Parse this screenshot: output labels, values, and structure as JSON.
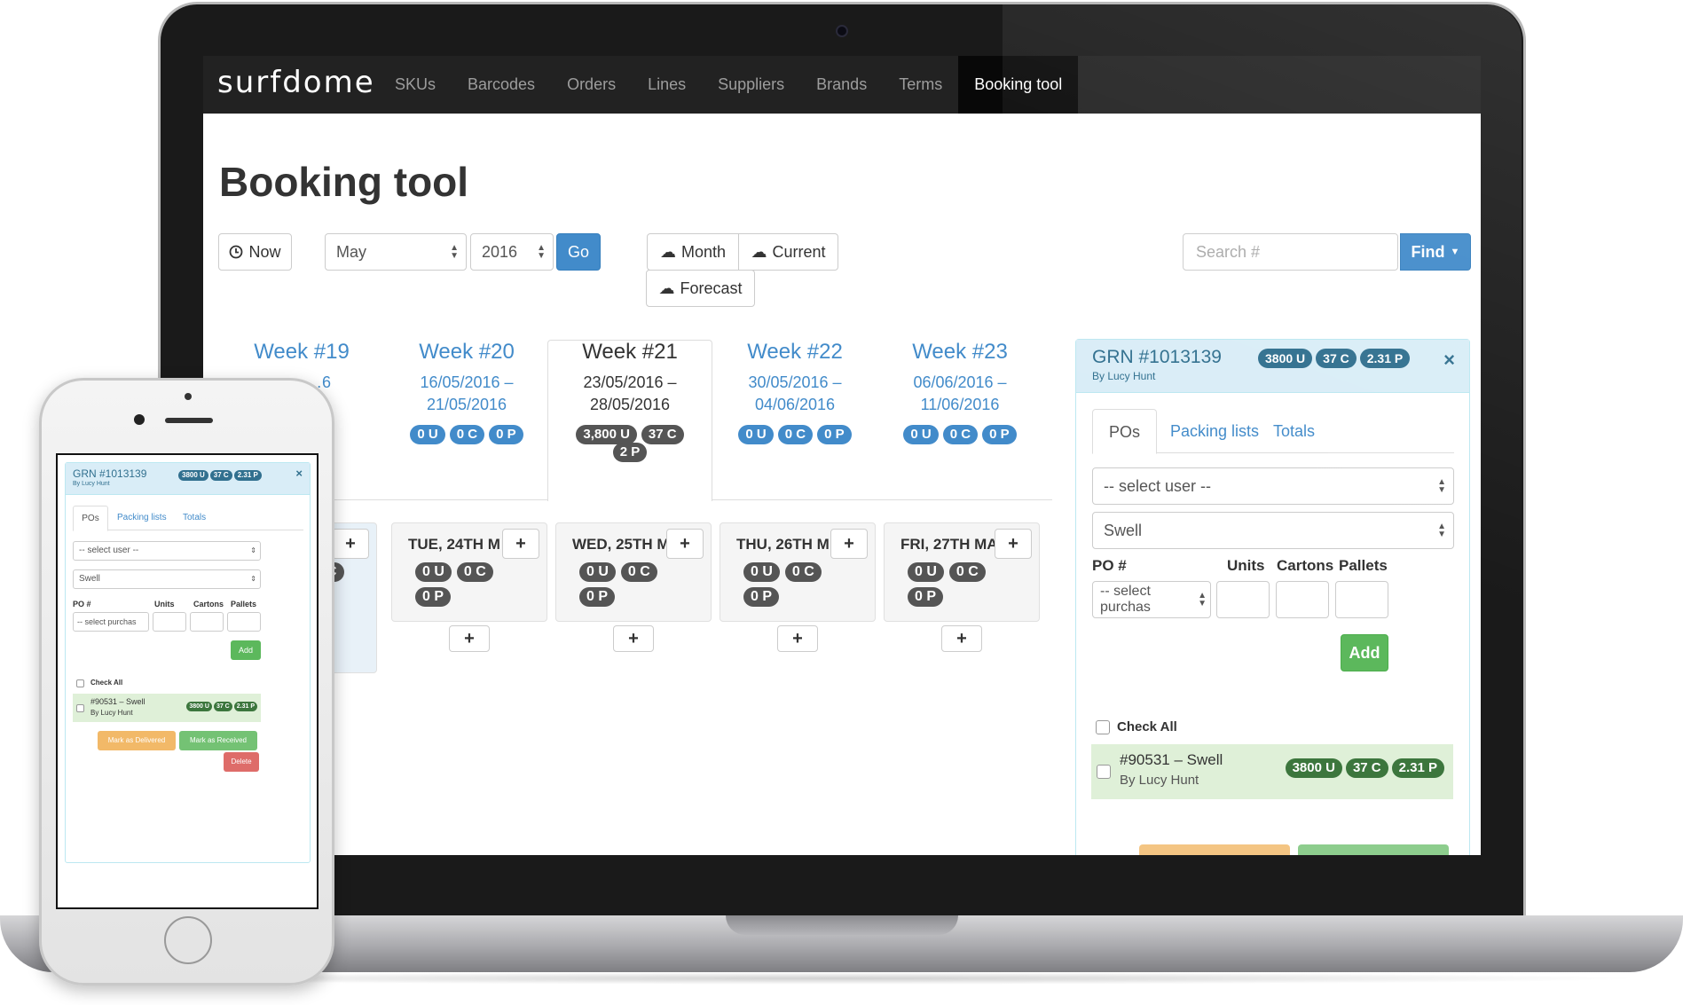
{
  "app": {
    "brand": "surfdome",
    "nav": [
      "SKUs",
      "Barcodes",
      "Orders",
      "Lines",
      "Suppliers",
      "Brands",
      "Terms",
      "Booking tool"
    ],
    "active_nav": "Booking tool"
  },
  "page": {
    "title": "Booking tool"
  },
  "toolbar": {
    "now_label": "Now",
    "month_value": "May",
    "year_value": "2016",
    "go_label": "Go",
    "month_btn": "Month",
    "current_btn": "Current",
    "forecast_btn": "Forecast",
    "search_placeholder": "Search #",
    "find_label": "Find"
  },
  "weeks": [
    {
      "title": "Week #19",
      "dates": "… – …6",
      "badges": [
        "0 P"
      ]
    },
    {
      "title": "Week #20",
      "dates": "16/05/2016 – 21/05/2016",
      "badges": [
        "0 U",
        "0 C",
        "0 P"
      ]
    },
    {
      "title": "Week #21",
      "dates": "23/05/2016 – 28/05/2016",
      "badges": [
        "3,800 U",
        "37 C",
        "2 P"
      ]
    },
    {
      "title": "Week #22",
      "dates": "30/05/2016 – 04/06/2016",
      "badges": [
        "0 U",
        "0 C",
        "0 P"
      ]
    },
    {
      "title": "Week #23",
      "dates": "06/06/2016 – 11/06/2016",
      "badges": [
        "0 U",
        "0 C",
        "0 P"
      ]
    }
  ],
  "days": [
    {
      "title": "",
      "badges": [
        "C"
      ]
    },
    {
      "title": "TUE, 24TH M",
      "badges": [
        "0 U",
        "0 C",
        "0 P"
      ]
    },
    {
      "title": "WED, 25TH M",
      "badges": [
        "0 U",
        "0 C",
        "0 P"
      ]
    },
    {
      "title": "THU, 26TH M",
      "badges": [
        "0 U",
        "0 C",
        "0 P"
      ]
    },
    {
      "title": "FRI, 27TH MA",
      "badges": [
        "0 U",
        "0 C",
        "0 P"
      ]
    }
  ],
  "grn": {
    "title": "GRN #1013139",
    "by": "By Lucy Hunt",
    "badges": [
      "3800 U",
      "37 C",
      "2.31 P"
    ],
    "close": "×",
    "tabs": [
      "POs",
      "Packing lists",
      "Totals"
    ],
    "user_select": "-- select user --",
    "supplier_select": "Swell",
    "columns": {
      "po": "PO #",
      "units": "Units",
      "cartons": "Cartons",
      "pallets": "Pallets"
    },
    "po_select": "-- select purchas",
    "add_label": "Add",
    "check_all": "Check All",
    "po_row": {
      "title": "#90531 – Swell",
      "by": "By Lucy Hunt",
      "badges": [
        "3800 U",
        "37 C",
        "2.31 P"
      ]
    }
  },
  "mobile": {
    "grn_title": "GRN #1013139",
    "grn_by": "By Lucy Hunt",
    "badges": [
      "3800 U",
      "37 C",
      "2.31 P"
    ],
    "close": "×",
    "tabs": [
      "POs",
      "Packing lists",
      "Totals"
    ],
    "user_select": "-- select user --",
    "supplier_select": "Swell",
    "columns": {
      "po": "PO #",
      "units": "Units",
      "cartons": "Cartons",
      "pallets": "Pallets"
    },
    "po_select": "-- select purchas",
    "add_label": "Add",
    "check_all": "Check All",
    "po_row": {
      "title": "#90531 – Swell",
      "by": "By Lucy Hunt",
      "badges": [
        "3800 U",
        "37 C",
        "2.31 P"
      ]
    },
    "mark_delivered": "Mark as Delivered",
    "mark_received": "Mark as Received",
    "delete_label": "Delete"
  },
  "colors": {
    "primary": "#428bca",
    "success": "#5cb85c",
    "warning": "#f0ad4e",
    "danger": "#d9534f",
    "info_bg": "#d9edf7",
    "navbar": "#222222"
  }
}
